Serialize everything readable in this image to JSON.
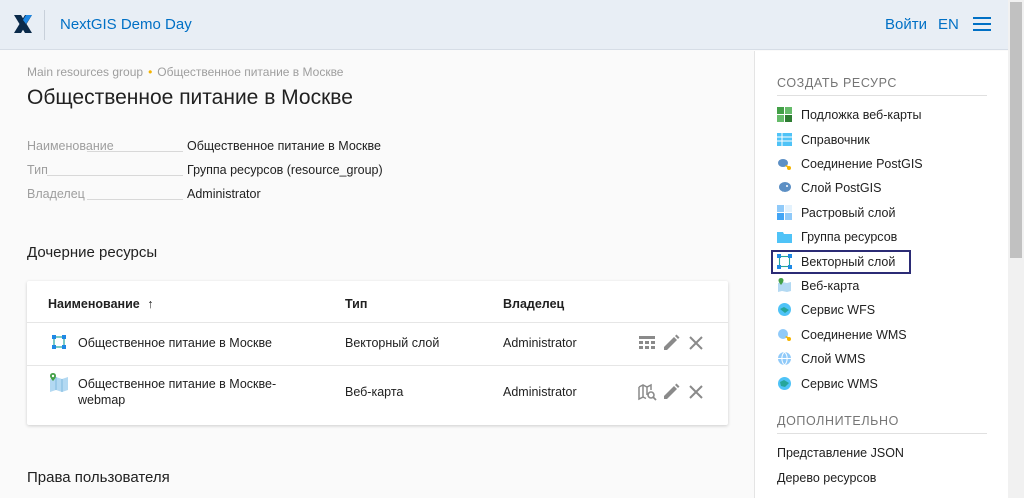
{
  "header": {
    "title": "NextGIS Demo Day",
    "login": "Войти",
    "lang": "EN"
  },
  "breadcrumb": {
    "parent": "Main resources group",
    "current": "Общественное питание в Москве"
  },
  "page_title": "Общественное питание в Москве",
  "properties": [
    {
      "label": "Наименование",
      "value": "Общественное питание в Москве"
    },
    {
      "label": "Тип",
      "value": "Группа ресурсов (resource_group)"
    },
    {
      "label": "Владелец",
      "value": "Administrator"
    }
  ],
  "children": {
    "title": "Дочерние ресурсы",
    "columns": {
      "name": "Наименование",
      "sort_arrow": "↑",
      "type": "Тип",
      "owner": "Владелец"
    },
    "rows": [
      {
        "name": "Общественное питание в Москве",
        "type": "Векторный слой",
        "owner": "Administrator",
        "icon": "vector-layer-icon"
      },
      {
        "name_line1": "Общественное питание в Москве-",
        "name_line2": "webmap",
        "type": "Веб-карта",
        "owner": "Administrator",
        "icon": "webmap-icon"
      }
    ]
  },
  "permissions_title": "Права пользователя",
  "sidebar": {
    "create_title": "СОЗДАТЬ РЕСУРС",
    "create_items": [
      {
        "label": "Подложка веб-карты",
        "icon": "basemap-icon"
      },
      {
        "label": "Справочник",
        "icon": "lookup-table-icon"
      },
      {
        "label": "Соединение PostGIS",
        "icon": "postgis-connection-icon"
      },
      {
        "label": "Слой PostGIS",
        "icon": "postgis-layer-icon"
      },
      {
        "label": "Растровый слой",
        "icon": "raster-layer-icon"
      },
      {
        "label": "Группа ресурсов",
        "icon": "resource-group-icon"
      },
      {
        "label": "Векторный слой",
        "icon": "vector-layer-icon"
      },
      {
        "label": "Веб-карта",
        "icon": "webmap-icon"
      },
      {
        "label": "Сервис WFS",
        "icon": "wfs-service-icon"
      },
      {
        "label": "Соединение WMS",
        "icon": "wms-connection-icon"
      },
      {
        "label": "Слой WMS",
        "icon": "wms-layer-icon"
      },
      {
        "label": "Сервис WMS",
        "icon": "wms-service-icon"
      }
    ],
    "extra_title": "ДОПОЛНИТЕЛЬНО",
    "extra_items": [
      {
        "label": "Представление JSON"
      },
      {
        "label": "Дерево ресурсов"
      }
    ]
  },
  "colors": {
    "accent": "#0070c5",
    "highlight_border": "#2b2b75",
    "breadcrumb_dot": "#f5b400"
  }
}
